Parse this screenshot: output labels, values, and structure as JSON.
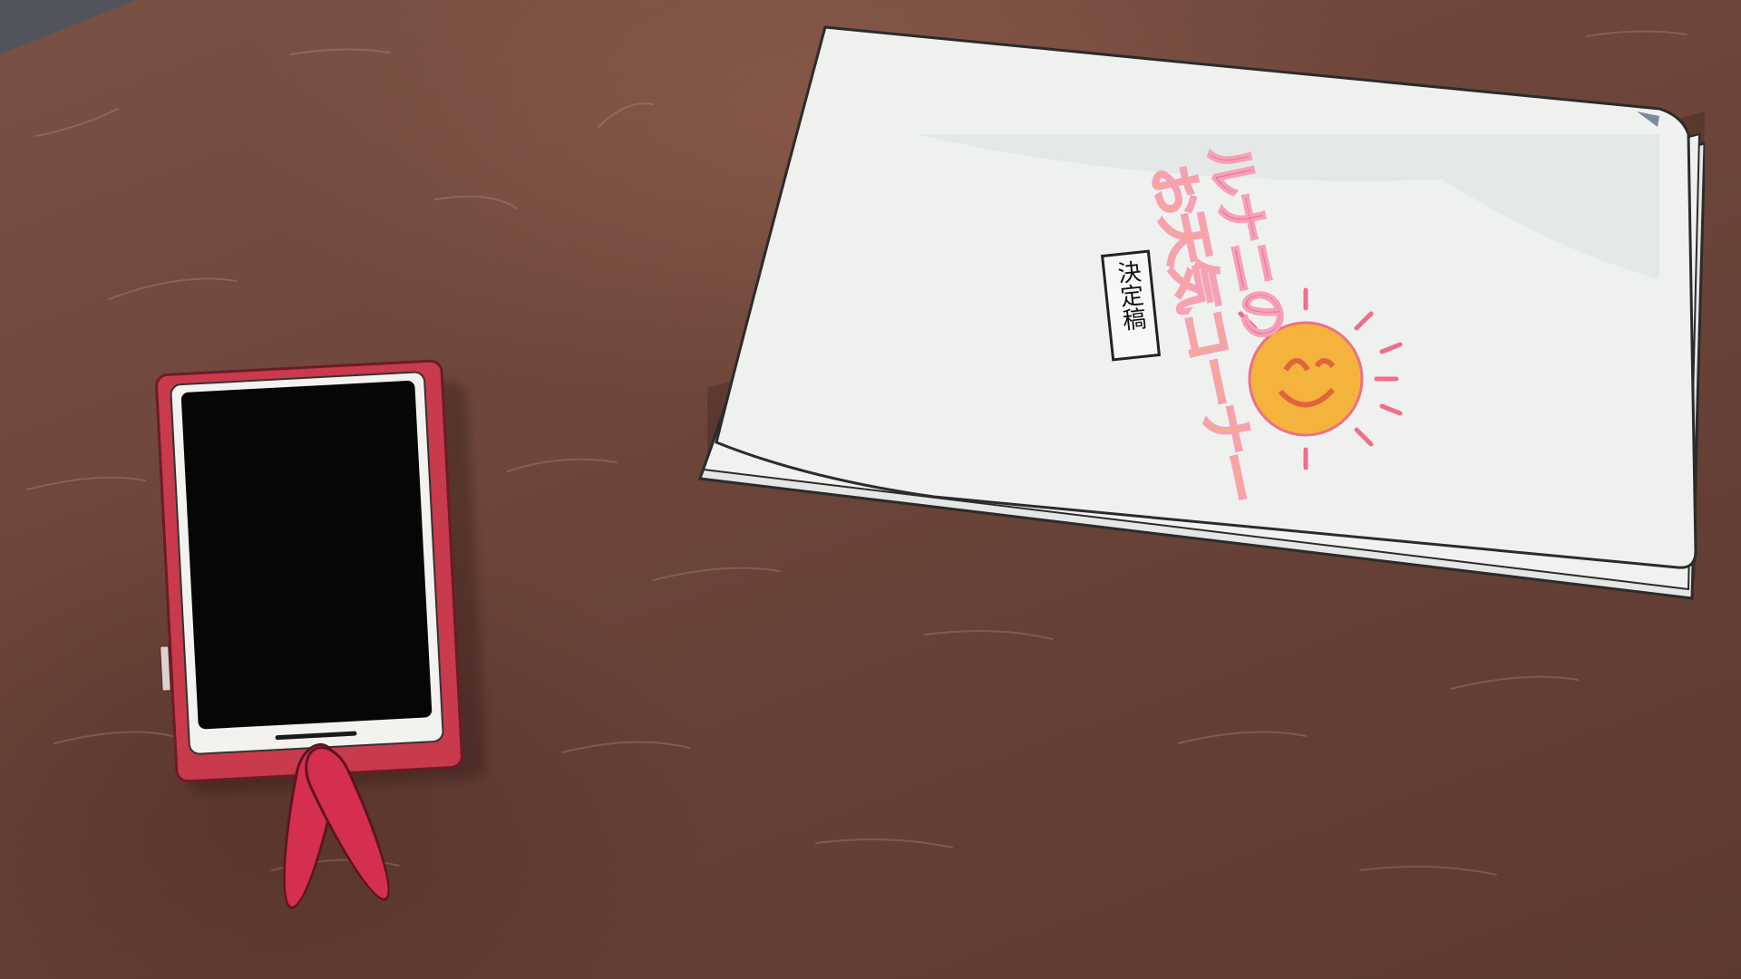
{
  "scene": {
    "description_labels": {
      "desk": "wooden desk surface",
      "phone": "smartphone with red case and bunny-ear strap",
      "document": "stapled paper document"
    },
    "document": {
      "title_line_1": "ルナニの",
      "title_line_2": "お天気コーナー",
      "stamp_text": "決定稿"
    },
    "colors": {
      "desk": "#6f463b",
      "phone_case": "#c83a4c",
      "phone_screen": "#060606",
      "strap": "#d52f4f",
      "paper": "#eef1ee",
      "title_pink": "#ec6e9a",
      "title_yellow": "#f2b84a",
      "title_cyan": "#6cc6d2",
      "sun": "#f3b33d"
    }
  }
}
